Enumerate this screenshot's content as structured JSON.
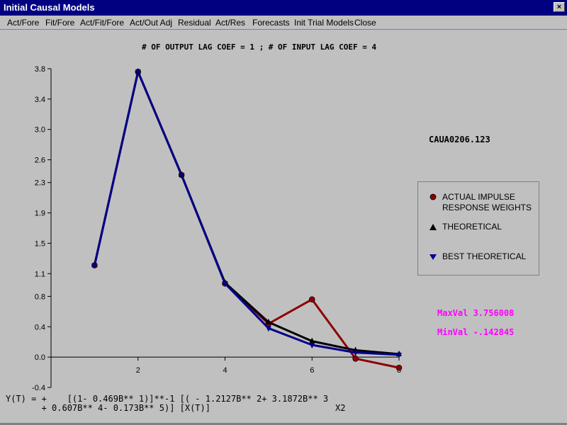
{
  "window": {
    "title": "Initial Causal Models",
    "close_glyph": "×"
  },
  "menu": [
    {
      "label": "Act/Fore",
      "x": 10
    },
    {
      "label": "Fit/Fore",
      "x": 64
    },
    {
      "label": "Act/Fit/Fore",
      "x": 113
    },
    {
      "label": "Act/Out Adj",
      "x": 183
    },
    {
      "label": "Residual",
      "x": 251
    },
    {
      "label": "Act/Res",
      "x": 304
    },
    {
      "label": "Forecasts",
      "x": 356
    },
    {
      "label": "Init Trial Models",
      "x": 415
    },
    {
      "label": "Close",
      "x": 500
    }
  ],
  "header": {
    "subtitle": "# OF OUTPUT LAG COEF = 1 ; # OF INPUT LAG COEF = 4"
  },
  "file_label": "CAUA0206.123",
  "stats": {
    "max": "MaxVal 3.756008",
    "min": "MinVal -.142845"
  },
  "equation": {
    "line1": "Y(T) = +    [(1- 0.469B** 1)]**-1 [( - 1.2127B** 2+ 3.1872B** 3",
    "line2": "       + 0.607B** 4- 0.173B** 5)] [X(T)]",
    "tag": "X2"
  },
  "legend": {
    "actual": "ACTUAL IMPULSE\nRESPONSE WEIGHTS",
    "actual_line1": "ACTUAL IMPULSE",
    "actual_line2": "RESPONSE WEIGHTS",
    "theoretical": "THEORETICAL",
    "best": "BEST THEORETICAL"
  },
  "colors": {
    "actual": "#8b0000",
    "theoretical": "#000000",
    "best": "#00008b",
    "stats": "#ff00ff"
  },
  "chart_data": {
    "type": "line",
    "xlim": [
      0,
      8
    ],
    "ylim": [
      -0.4,
      3.8
    ],
    "y_ticks": [
      3.8,
      3.4,
      3.0,
      2.6,
      2.3,
      1.9,
      1.5,
      1.1,
      0.8,
      0.4,
      0.0,
      -0.4
    ],
    "y_tick_labels": [
      "3.8",
      "3.4",
      "3.0",
      "2.6",
      "2.3",
      "1.9",
      "1.5",
      "1.1",
      "0.8",
      "0.4",
      "0.0",
      "-0.4"
    ],
    "x_ticks": [
      2,
      4,
      6,
      8
    ],
    "x_tick_labels": [
      "2",
      "4",
      "6",
      "8"
    ],
    "series": [
      {
        "name": "ACTUAL IMPULSE RESPONSE WEIGHTS",
        "marker": "circle",
        "color": "#8b0000",
        "x": [
          1,
          2,
          3,
          4,
          5,
          6,
          7,
          8
        ],
        "y": [
          1.21,
          3.76,
          2.4,
          0.97,
          0.44,
          0.76,
          -0.02,
          -0.14
        ]
      },
      {
        "name": "THEORETICAL",
        "marker": "triangle-up",
        "color": "#000000",
        "x": [
          1,
          2,
          3,
          4,
          5,
          6,
          7,
          8
        ],
        "y": [
          1.21,
          3.76,
          2.4,
          0.98,
          0.46,
          0.21,
          0.09,
          0.04
        ]
      },
      {
        "name": "BEST THEORETICAL",
        "marker": "triangle-down",
        "color": "#00008b",
        "x": [
          1,
          2,
          3,
          4,
          5,
          6,
          7,
          8
        ],
        "y": [
          1.21,
          3.76,
          2.4,
          0.97,
          0.38,
          0.16,
          0.06,
          0.03
        ]
      }
    ]
  }
}
